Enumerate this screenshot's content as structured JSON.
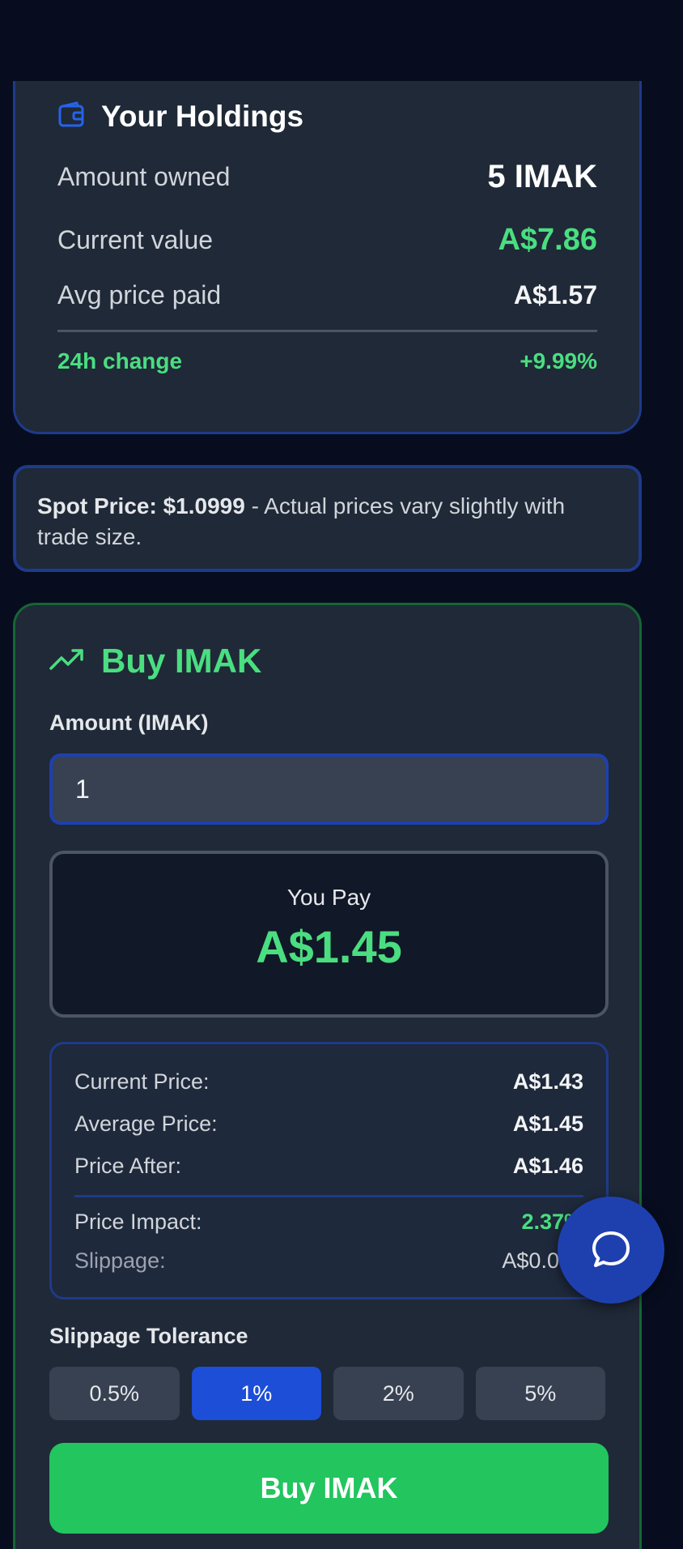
{
  "holdings": {
    "title": "Your Holdings",
    "icon": "wallet-icon",
    "amount_owned_label": "Amount owned",
    "amount_owned_value": "5 IMAK",
    "current_value_label": "Current value",
    "current_value": "A$7.86",
    "avg_price_label": "Avg price paid",
    "avg_price_value": "A$1.57",
    "change_label": "24h change",
    "change_value": "+9.99%"
  },
  "spot": {
    "label": "Spot Price: $1.0999",
    "note": " - Actual prices vary slightly with trade size."
  },
  "buy": {
    "title": "Buy IMAK",
    "icon": "trending-up-icon",
    "amount_label": "Amount (IMAK)",
    "amount_value": "1",
    "you_pay_label": "You Pay",
    "you_pay_value": "A$1.45",
    "details": {
      "current_price_label": "Current Price:",
      "current_price": "A$1.43",
      "average_price_label": "Average Price:",
      "average_price": "A$1.45",
      "price_after_label": "Price After:",
      "price_after": "A$1.46",
      "price_impact_label": "Price Impact:",
      "price_impact": "2.37%",
      "slippage_label": "Slippage:",
      "slippage": "A$0.016"
    },
    "tolerance_label": "Slippage Tolerance",
    "tolerance_options": [
      "0.5%",
      "1%",
      "2%",
      "5%"
    ],
    "tolerance_selected": "1%",
    "buy_button_label": "Buy IMAK"
  },
  "colors": {
    "background": "#070d1f",
    "card": "#1f2937",
    "accent_blue": "#1d4ed8",
    "positive_green": "#4ade80",
    "buy_button": "#22c55e"
  },
  "chat": {
    "icon": "chat-bubble-icon"
  }
}
